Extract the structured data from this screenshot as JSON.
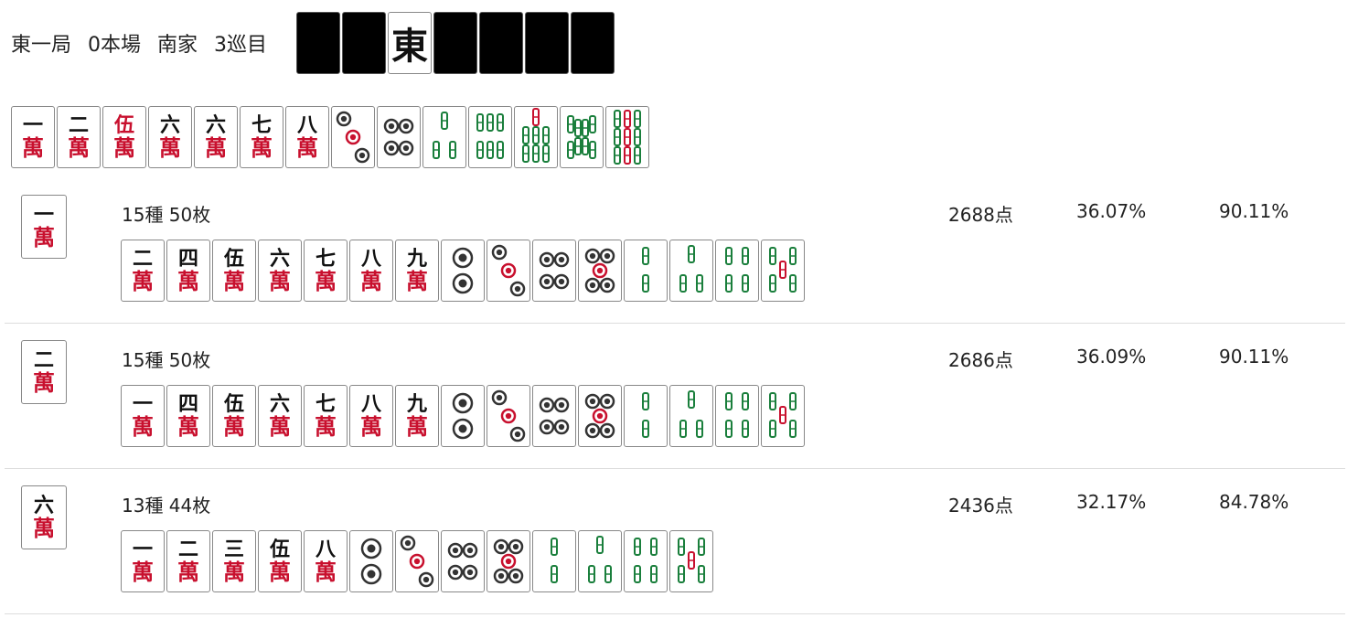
{
  "header": {
    "round": "東一局",
    "honba": "0本場",
    "seat": "南家",
    "turn": "3巡目",
    "dora_wall": [
      "back",
      "back",
      "東",
      "back",
      "back",
      "back",
      "back"
    ]
  },
  "colors": {
    "man_red": "#c8102e",
    "sou_green": "#1a7f3c",
    "pin_black": "#333333",
    "tile_border": "#888888"
  },
  "hand": [
    {
      "s": "m",
      "n": "一"
    },
    {
      "s": "m",
      "n": "二"
    },
    {
      "s": "m",
      "n": "伍",
      "red": true
    },
    {
      "s": "m",
      "n": "六"
    },
    {
      "s": "m",
      "n": "六"
    },
    {
      "s": "m",
      "n": "七"
    },
    {
      "s": "m",
      "n": "八"
    },
    {
      "s": "p",
      "n": "3"
    },
    {
      "s": "p",
      "n": "4"
    },
    {
      "s": "s",
      "n": "3"
    },
    {
      "s": "s",
      "n": "6"
    },
    {
      "s": "s",
      "n": "7"
    },
    {
      "s": "s",
      "n": "8"
    },
    {
      "s": "s",
      "n": "9"
    }
  ],
  "rows": [
    {
      "discard": {
        "s": "m",
        "n": "一"
      },
      "summary": "15種 50枚",
      "points": "2688点",
      "p1": "36.07%",
      "p2": "90.11%",
      "waits": [
        {
          "s": "m",
          "n": "二"
        },
        {
          "s": "m",
          "n": "四"
        },
        {
          "s": "m",
          "n": "伍"
        },
        {
          "s": "m",
          "n": "六"
        },
        {
          "s": "m",
          "n": "七"
        },
        {
          "s": "m",
          "n": "八"
        },
        {
          "s": "m",
          "n": "九"
        },
        {
          "s": "p",
          "n": "2"
        },
        {
          "s": "p",
          "n": "3"
        },
        {
          "s": "p",
          "n": "4"
        },
        {
          "s": "p",
          "n": "5"
        },
        {
          "s": "s",
          "n": "2"
        },
        {
          "s": "s",
          "n": "3"
        },
        {
          "s": "s",
          "n": "4"
        },
        {
          "s": "s",
          "n": "5"
        }
      ]
    },
    {
      "discard": {
        "s": "m",
        "n": "二"
      },
      "summary": "15種 50枚",
      "points": "2686点",
      "p1": "36.09%",
      "p2": "90.11%",
      "waits": [
        {
          "s": "m",
          "n": "一"
        },
        {
          "s": "m",
          "n": "四"
        },
        {
          "s": "m",
          "n": "伍"
        },
        {
          "s": "m",
          "n": "六"
        },
        {
          "s": "m",
          "n": "七"
        },
        {
          "s": "m",
          "n": "八"
        },
        {
          "s": "m",
          "n": "九"
        },
        {
          "s": "p",
          "n": "2"
        },
        {
          "s": "p",
          "n": "3"
        },
        {
          "s": "p",
          "n": "4"
        },
        {
          "s": "p",
          "n": "5"
        },
        {
          "s": "s",
          "n": "2"
        },
        {
          "s": "s",
          "n": "3"
        },
        {
          "s": "s",
          "n": "4"
        },
        {
          "s": "s",
          "n": "5"
        }
      ]
    },
    {
      "discard": {
        "s": "m",
        "n": "六"
      },
      "summary": "13種 44枚",
      "points": "2436点",
      "p1": "32.17%",
      "p2": "84.78%",
      "waits": [
        {
          "s": "m",
          "n": "一"
        },
        {
          "s": "m",
          "n": "二"
        },
        {
          "s": "m",
          "n": "三"
        },
        {
          "s": "m",
          "n": "伍"
        },
        {
          "s": "m",
          "n": "八"
        },
        {
          "s": "p",
          "n": "2"
        },
        {
          "s": "p",
          "n": "3"
        },
        {
          "s": "p",
          "n": "4"
        },
        {
          "s": "p",
          "n": "5"
        },
        {
          "s": "s",
          "n": "2"
        },
        {
          "s": "s",
          "n": "3"
        },
        {
          "s": "s",
          "n": "4"
        },
        {
          "s": "s",
          "n": "5"
        }
      ]
    }
  ]
}
